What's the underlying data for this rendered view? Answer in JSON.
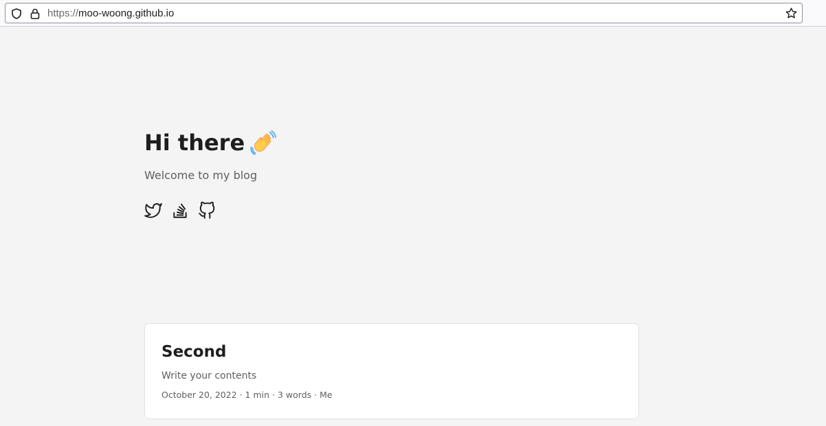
{
  "browser": {
    "url_scheme": "https://",
    "url_host": "moo-woong.github.io"
  },
  "hero": {
    "title": "Hi there",
    "subtitle": "Welcome to my blog",
    "social_icons": [
      "twitter-icon",
      "stackoverflow-icon",
      "github-icon"
    ]
  },
  "posts": [
    {
      "title": "Second",
      "summary": "Write your contents",
      "meta": "October 20, 2022 · 1 min · 3 words · Me"
    }
  ],
  "colors": {
    "background": "#f4f4f4",
    "card": "#ffffff",
    "primary_text": "#1e1e1e",
    "secondary_text": "#5e5e5e"
  }
}
